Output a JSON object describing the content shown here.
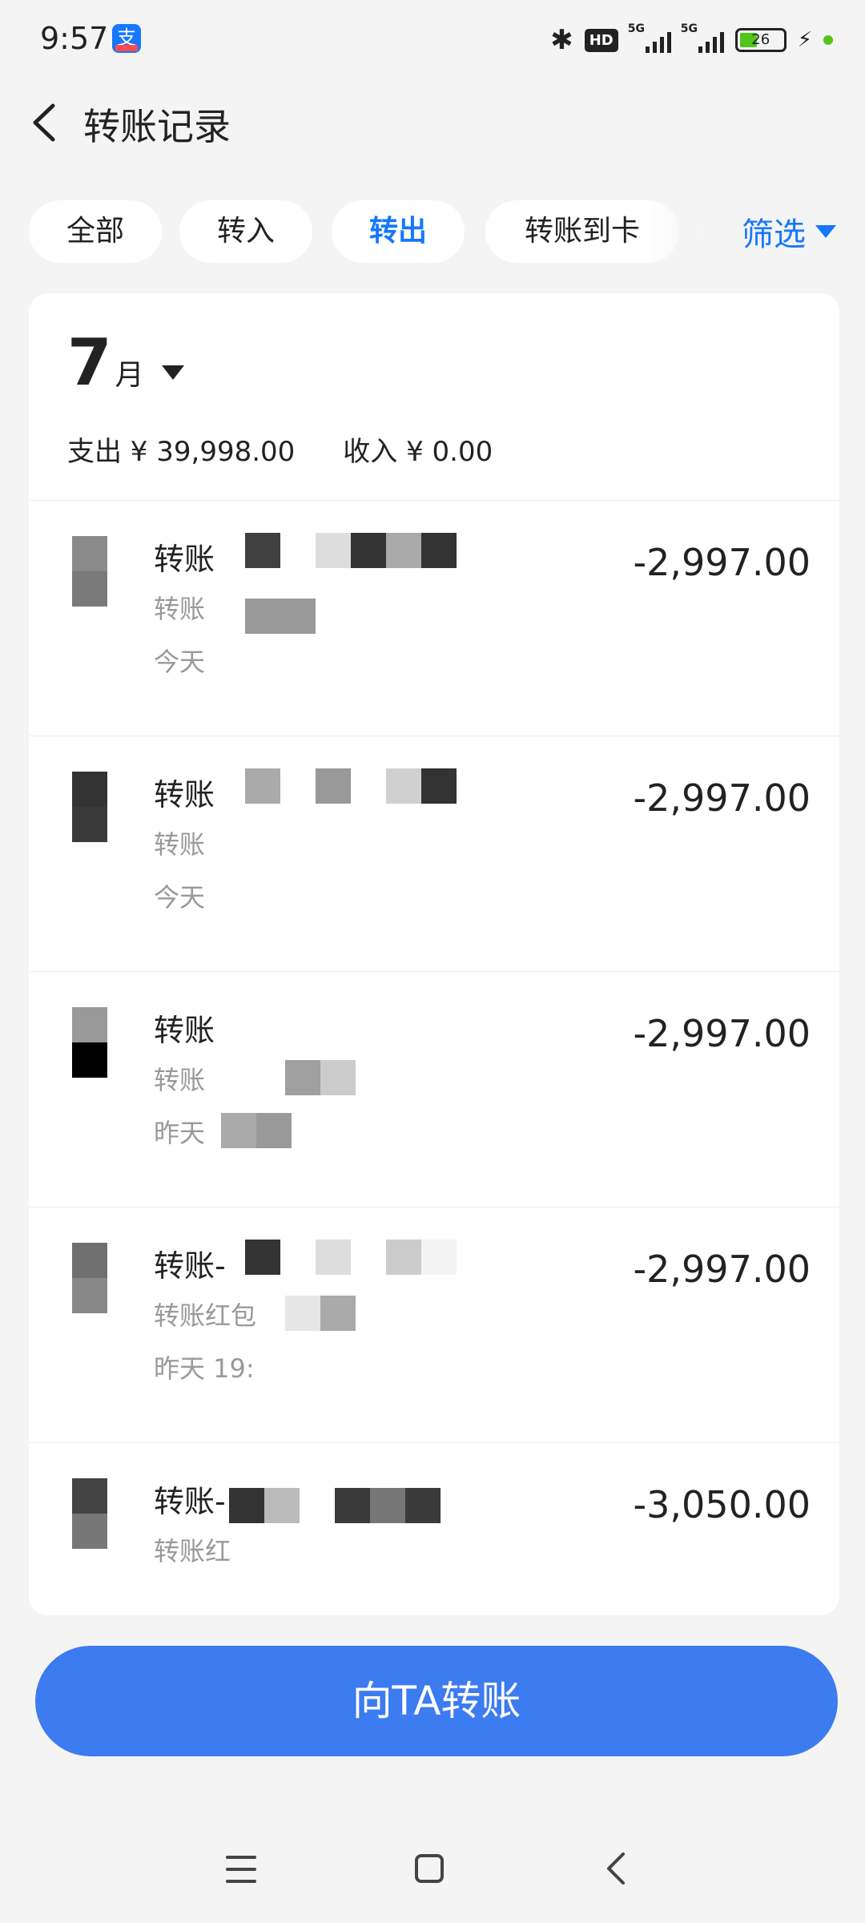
{
  "status_bar": {
    "time": "9:57",
    "app_badge": "支",
    "hd_label": "HD",
    "network_1": "5G",
    "network_2": "5G",
    "battery_level": "26"
  },
  "header": {
    "title": "转账记录"
  },
  "filters": {
    "chips": [
      "全部",
      "转入",
      "转出",
      "转账到卡"
    ],
    "active_chip": "转出",
    "filter_label": "筛选"
  },
  "month_section": {
    "month_number": "7",
    "month_unit": "月",
    "expense_label": "支出 ¥ 39,998.00",
    "income_label": "收入 ¥ 0.00"
  },
  "transactions": [
    {
      "title": "转账",
      "sub": "转账",
      "date": "今天",
      "amount": "-2,997.00"
    },
    {
      "title": "转账",
      "sub": "转账",
      "date": "今天",
      "amount": "-2,997.00"
    },
    {
      "title": "转账",
      "sub": "转账",
      "date": "昨天",
      "amount": "-2,997.00"
    },
    {
      "title": "转账-",
      "sub": "转账红包",
      "date": "昨天 19:",
      "amount": "-2,997.00"
    },
    {
      "title": "转账-",
      "sub": "转账红",
      "date": "",
      "amount": "-3,050.00"
    }
  ],
  "cta": {
    "label": "向TA转账"
  },
  "colors": {
    "accent": "#1677ff",
    "button": "#3d7bf0",
    "background": "#f4f4f4"
  },
  "icons": {
    "back": "chevron-left-icon",
    "filter": "triangle-down-icon",
    "nav_menu": "menu-icon",
    "nav_home": "home-square-icon",
    "nav_back": "back-icon"
  }
}
